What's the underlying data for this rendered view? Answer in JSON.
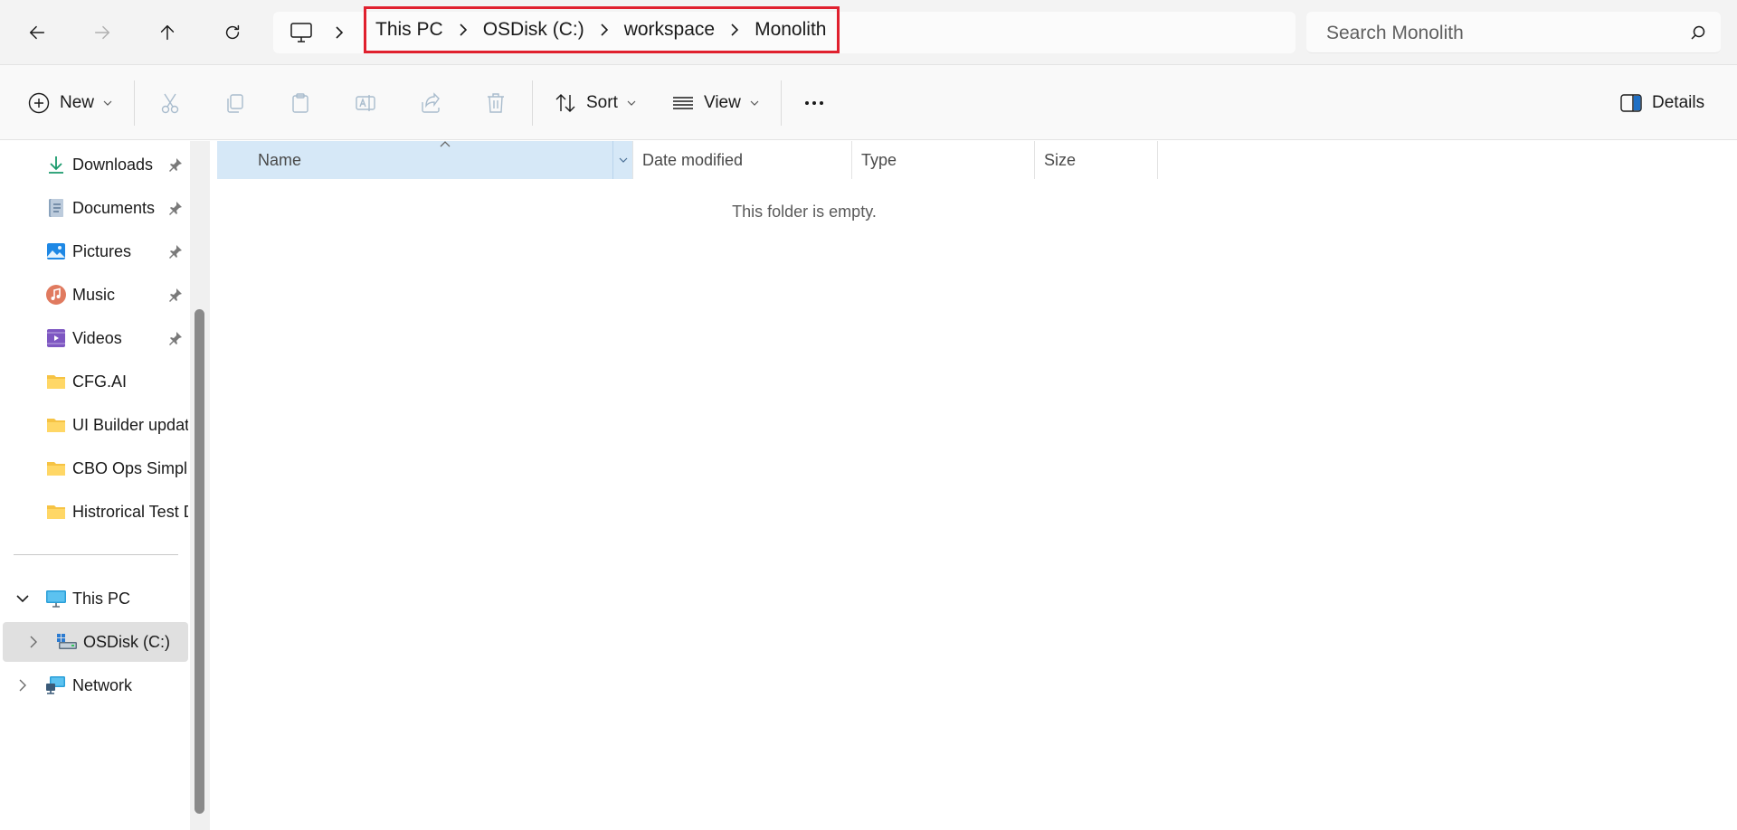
{
  "breadcrumb": {
    "items": [
      "This PC",
      "OSDisk (C:)",
      "workspace",
      "Monolith"
    ]
  },
  "search": {
    "placeholder": "Search Monolith"
  },
  "toolbar": {
    "new_label": "New",
    "sort_label": "Sort",
    "view_label": "View",
    "details_label": "Details"
  },
  "sidebar": {
    "quick_access": [
      {
        "label": "Downloads",
        "icon": "download-icon",
        "pinned": true
      },
      {
        "label": "Documents",
        "icon": "documents-icon",
        "pinned": true
      },
      {
        "label": "Pictures",
        "icon": "pictures-icon",
        "pinned": true
      },
      {
        "label": "Music",
        "icon": "music-icon",
        "pinned": true
      },
      {
        "label": "Videos",
        "icon": "videos-icon",
        "pinned": true
      },
      {
        "label": "CFG.AI",
        "icon": "folder-icon",
        "pinned": false
      },
      {
        "label": "UI Builder updat",
        "icon": "folder-icon",
        "pinned": false
      },
      {
        "label": "CBO Ops Simpli",
        "icon": "folder-icon",
        "pinned": false
      },
      {
        "label": "Histrorical Test D",
        "icon": "folder-icon",
        "pinned": false
      }
    ],
    "this_pc": "This PC",
    "osdisk": "OSDisk (C:)",
    "network": "Network"
  },
  "columns": {
    "name": "Name",
    "date_modified": "Date modified",
    "type": "Type",
    "size": "Size"
  },
  "content": {
    "empty_message": "This folder is empty."
  },
  "colors": {
    "highlight_border": "#e0202e",
    "sorted_column_bg": "#d6e8f7",
    "selected_nav_bg": "#e0e0e0"
  }
}
